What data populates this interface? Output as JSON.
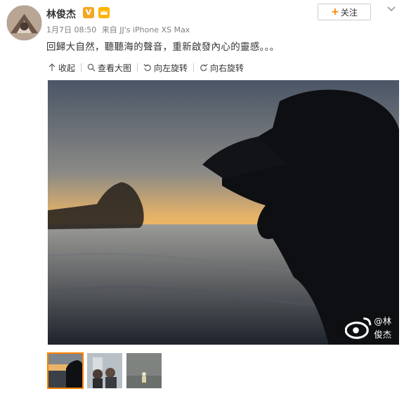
{
  "post": {
    "author": "林俊杰",
    "verified_badge": "V",
    "follow_label": "关注",
    "timestamp": "1月7日 08:50",
    "source": "来自 JJ's iPhone XS Max",
    "content": "回歸大自然，聽聽海的聲音，重新啟發內心的靈感。。。"
  },
  "toolbar": {
    "collect": "收起",
    "view_large": "查看大图",
    "rotate_left": "向左旋转",
    "rotate_right": "向右旋转"
  },
  "image": {
    "watermark": "@林俊杰"
  },
  "thumbnails": {
    "count": 3,
    "selected_index": 0
  },
  "colors": {
    "accent": "#ff8200",
    "badge": "#f5a623",
    "meta_text": "#808080"
  }
}
